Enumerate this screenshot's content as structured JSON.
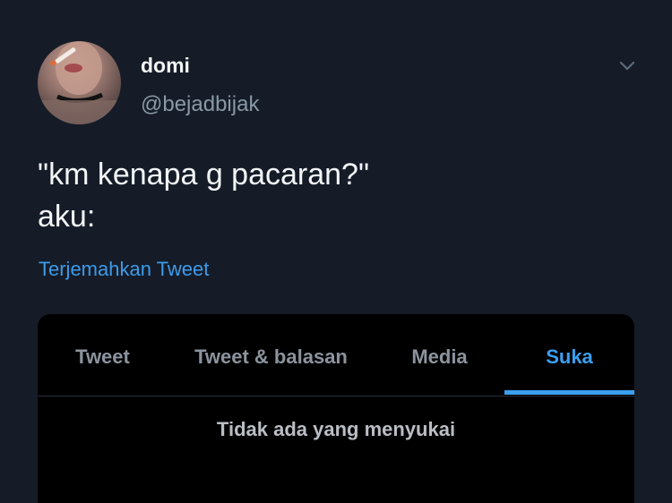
{
  "tweet": {
    "display_name": "domi",
    "handle": "@bejadbijak",
    "text": "\"km kenapa g pacaran?\"\naku:",
    "translate_label": "Terjemahkan Tweet",
    "avatar_icon": "profile-photo",
    "menu_icon": "chevron-down-icon"
  },
  "embedded_card": {
    "tabs": [
      {
        "label": "Tweet"
      },
      {
        "label": "Tweet & balasan"
      },
      {
        "label": "Media"
      },
      {
        "label": "Suka"
      }
    ],
    "active_tab": "Suka",
    "empty_message": "Tidak ada yang menyukai"
  },
  "colors": {
    "background": "#151c28",
    "accent": "#3b9ff0",
    "card_background": "#000000"
  }
}
